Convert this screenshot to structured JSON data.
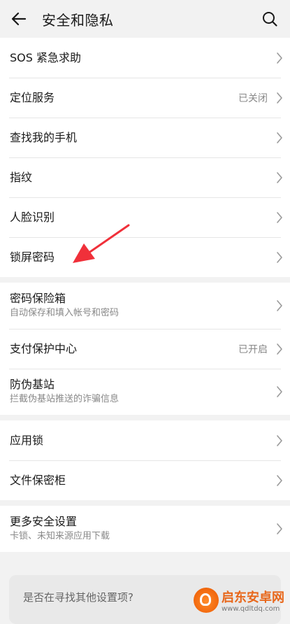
{
  "header": {
    "title": "安全和隐私",
    "back_icon": "arrow-left-icon",
    "search_icon": "search-icon"
  },
  "groups": [
    {
      "items": [
        {
          "label": "SOS 紧急求助"
        },
        {
          "label": "定位服务",
          "status": "已关闭"
        },
        {
          "label": "查找我的手机"
        },
        {
          "label": "指纹"
        },
        {
          "label": "人脸识别"
        },
        {
          "label": "锁屏密码"
        }
      ]
    },
    {
      "items": [
        {
          "label": "密码保险箱",
          "sub": "自动保存和填入帐号和密码"
        },
        {
          "label": "支付保护中心",
          "status": "已开启"
        },
        {
          "label": "防伪基站",
          "sub": "拦截伪基站推送的诈骗信息"
        }
      ]
    },
    {
      "items": [
        {
          "label": "应用锁"
        },
        {
          "label": "文件保密柜"
        }
      ]
    },
    {
      "items": [
        {
          "label": "更多安全设置",
          "sub": "卡锁、未知来源应用下载"
        }
      ]
    }
  ],
  "suggest": {
    "text": "是否在寻找其他设置项?"
  },
  "watermark": {
    "name": "启东安卓网",
    "url": "www.qdltdq.com"
  },
  "colors": {
    "background": "#f2f2f2",
    "card": "#ffffff",
    "annotation_arrow": "#f0303a",
    "watermark": "#e8671a"
  }
}
